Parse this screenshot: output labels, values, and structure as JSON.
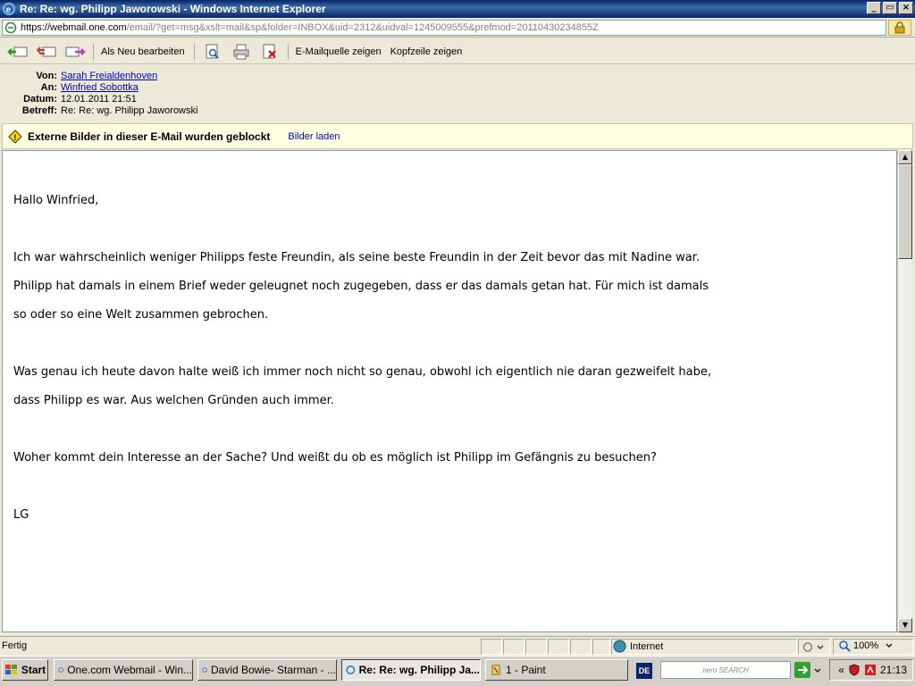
{
  "window": {
    "title": "Re: Re: wg. Philipp Jaworowski - Windows Internet Explorer",
    "min": "_",
    "max": "▭",
    "close": "×"
  },
  "address": {
    "proto": "https://",
    "domain": "webmail.one.com",
    "rest": "/email/?get=msg&xslt=mail&sp&folder=INBOX&uid=2312&uidval=1245009555&prefmod=20110430234855Z"
  },
  "toolbar": {
    "mark_new": "Als Neu bearbeiten",
    "source": "E-Mailquelle zeigen",
    "headers": "Kopfzeile zeigen"
  },
  "mail": {
    "from_key": "Von:",
    "from": "Sarah Freialdenhoven",
    "to_key": "An:",
    "to": "Winfried Sobottka",
    "date_key": "Datum:",
    "date": "12.01.2011 21:51",
    "subject_key": "Betreff:",
    "subject": "Re: Re: wg. Philipp Jaworowski"
  },
  "notice": {
    "message": "Externe Bilder in dieser E-Mail wurden geblockt",
    "load": "Bilder laden"
  },
  "body": {
    "lines": [
      "Hallo Winfried,",
      "",
      "Ich war wahrscheinlich weniger Philipps feste Freundin, als seine beste Freundin in der Zeit bevor das mit Nadine war.",
      "Philipp hat damals in einem Brief weder geleugnet noch zugegeben, dass er das damals getan hat. Für mich ist damals",
      "so oder so eine Welt zusammen gebrochen.",
      "",
      "Was genau ich heute davon halte weiß ich immer noch nicht so genau, obwohl ich eigentlich nie daran gezweifelt habe,",
      "dass Philipp es war. Aus welchen Gründen auch immer.",
      "",
      "Woher kommt dein Interesse an der Sache? Und weißt du ob es möglich ist Philipp im Gefängnis zu besuchen?",
      "",
      "LG"
    ]
  },
  "status": {
    "text": "Fertig",
    "zone": "Internet",
    "zoom": "100%"
  },
  "taskbar": {
    "start": "Start",
    "tasks": [
      "One.com Webmail - Win...",
      "David Bowie- Starman - ...",
      "Re: Re: wg. Philipp Ja...",
      "1 - Paint"
    ],
    "lang": "DE",
    "search": "nero SEARCH",
    "chevron": "«",
    "clock": "21:13"
  }
}
